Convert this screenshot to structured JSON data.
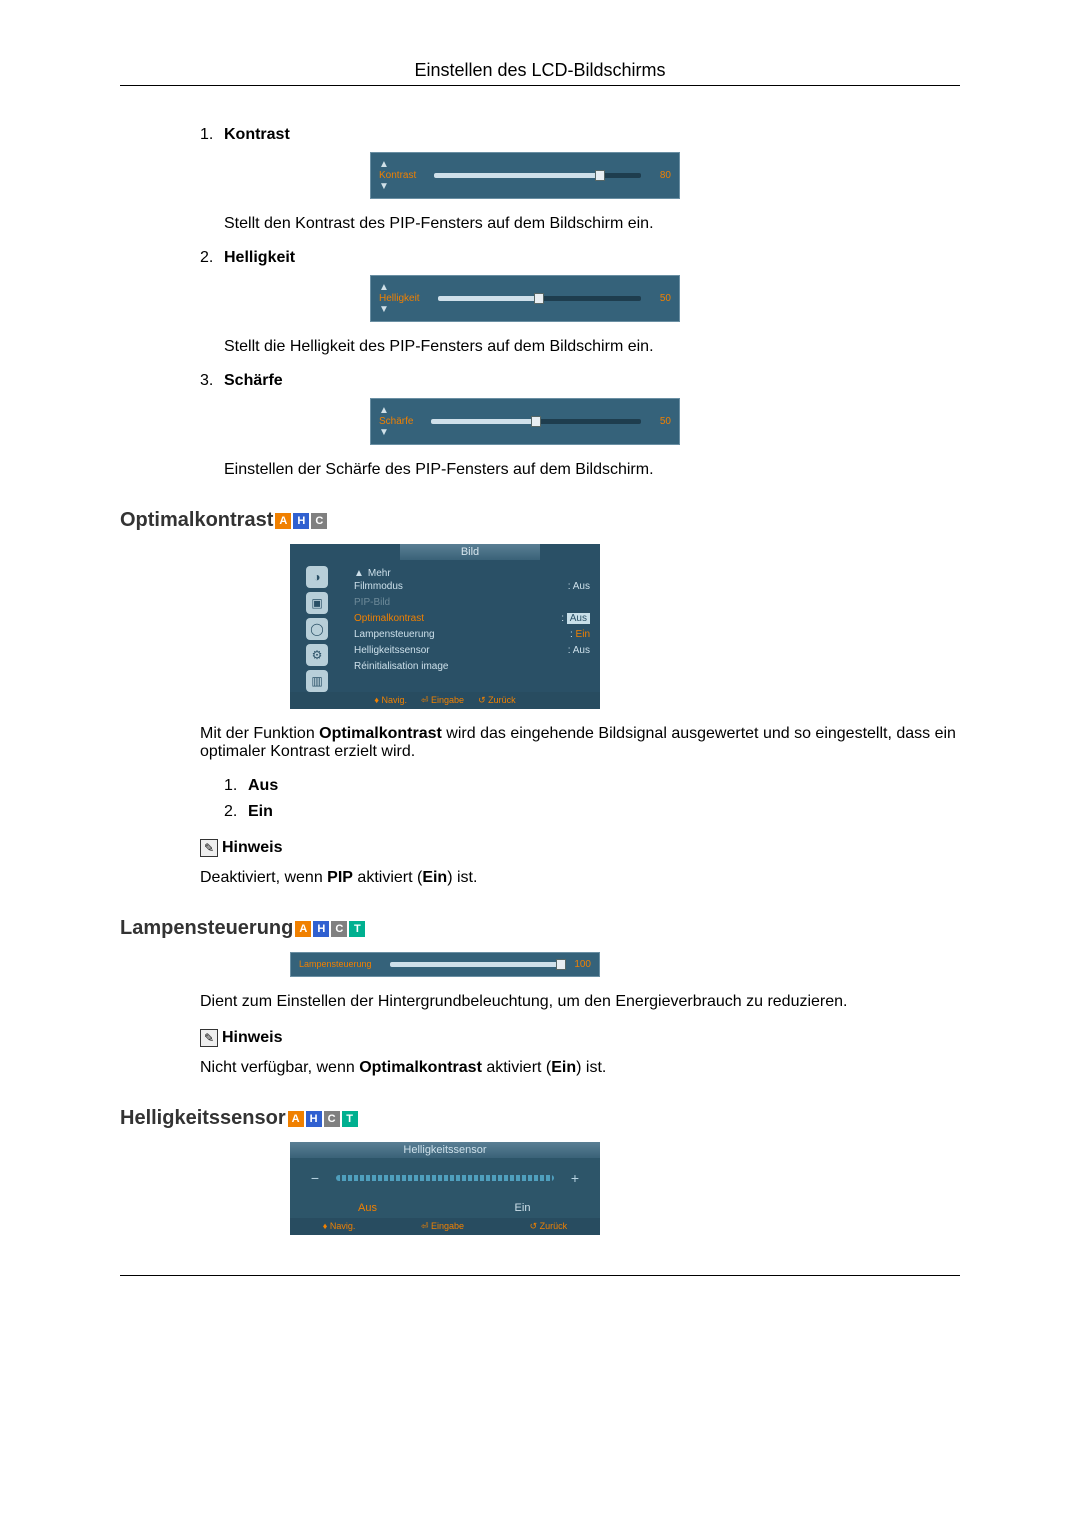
{
  "header": {
    "title": "Einstellen des LCD-Bildschirms"
  },
  "pip": {
    "items": [
      {
        "num": "1.",
        "label": "Kontrast",
        "slider": {
          "name": "Kontrast",
          "value": "80",
          "pct": 80
        },
        "desc": "Stellt den Kontrast des PIP-Fensters auf dem Bildschirm ein."
      },
      {
        "num": "2.",
        "label": "Helligkeit",
        "slider": {
          "name": "Helligkeit",
          "value": "50",
          "pct": 50
        },
        "desc": "Stellt die Helligkeit des PIP-Fensters auf dem Bildschirm ein."
      },
      {
        "num": "3.",
        "label": "Schärfe",
        "slider": {
          "name": "Schärfe",
          "value": "50",
          "pct": 50
        },
        "desc": "Einstellen der Schärfe des PIP-Fensters auf dem Bildschirm."
      }
    ]
  },
  "sections": {
    "optimal": {
      "title": "Optimalkontrast",
      "tags": [
        "A",
        "H",
        "C"
      ],
      "menu": {
        "tab": "Bild",
        "more": "Mehr",
        "rows": [
          {
            "label": "Filmmodus",
            "val": ": Aus",
            "cls": ""
          },
          {
            "label": "PIP-Bild",
            "val": "",
            "cls": "dim"
          },
          {
            "label": "Optimalkontrast",
            "val": "Aus",
            "cls": "hl",
            "valcls": "sel"
          },
          {
            "label": "Lampensteuerung",
            "val": "Ein",
            "cls": "",
            "valcls": "hl"
          },
          {
            "label": "Helligkeitssensor",
            "val": ": Aus",
            "cls": ""
          },
          {
            "label": "Réinitialisation image",
            "val": "",
            "cls": ""
          }
        ],
        "footer": [
          "Navig.",
          "Eingabe",
          "Zurück"
        ]
      },
      "para_pre": "Mit der Funktion ",
      "para_bold": "Optimalkontrast",
      "para_post": " wird das eingehende Bildsignal ausgewertet und so eingestellt, dass ein optimaler Kontrast erzielt wird.",
      "list": [
        {
          "num": "1.",
          "label": "Aus"
        },
        {
          "num": "2.",
          "label": "Ein"
        }
      ],
      "note_label": "Hinweis",
      "note_pre": "Deaktiviert, wenn ",
      "note_b1": "PIP",
      "note_mid": " aktiviert (",
      "note_b2": "Ein",
      "note_post": ") ist."
    },
    "lampe": {
      "title": "Lampensteuerung",
      "tags": [
        "A",
        "H",
        "C",
        "T"
      ],
      "slider": {
        "name": "Lampensteuerung",
        "value": "100",
        "pct": 100
      },
      "desc": "Dient zum Einstellen der Hintergrundbeleuchtung, um den Energieverbrauch zu reduzieren.",
      "note_label": "Hinweis",
      "note_pre": "Nicht verfügbar, wenn ",
      "note_b1": "Optimalkontrast",
      "note_mid": " aktiviert (",
      "note_b2": "Ein",
      "note_post": ") ist."
    },
    "sensor": {
      "title": "Helligkeitssensor",
      "tags": [
        "A",
        "H",
        "C",
        "T"
      ],
      "box": {
        "header": "Helligkeitssensor",
        "off": "Aus",
        "on": "Ein",
        "footer": [
          "Navig.",
          "Eingabe",
          "Zurück"
        ]
      }
    }
  }
}
